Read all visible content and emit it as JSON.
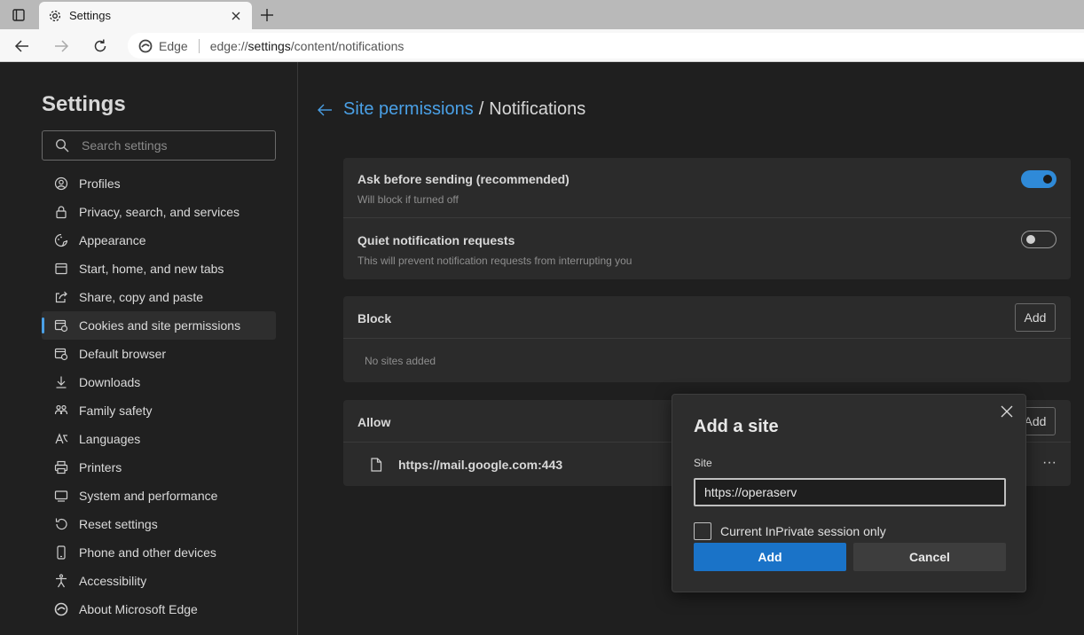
{
  "colors": {
    "accent": "#4aa0e6",
    "primary_button": "#1a73c8",
    "toggle_on": "#2f8ad8",
    "background": "#1f1f1f",
    "card": "#2b2b2b"
  },
  "browser": {
    "tab": {
      "title": "Settings",
      "icon": "gear-icon"
    },
    "address": {
      "edge_label": "Edge",
      "url_prefix": "edge://",
      "url_host": "settings",
      "url_path": "/content/notifications"
    }
  },
  "sidebar": {
    "title": "Settings",
    "search_placeholder": "Search settings",
    "items": [
      {
        "label": "Profiles",
        "icon": "profile-icon"
      },
      {
        "label": "Privacy, search, and services",
        "icon": "lock-icon"
      },
      {
        "label": "Appearance",
        "icon": "appearance-icon"
      },
      {
        "label": "Start, home, and new tabs",
        "icon": "home-tabs-icon"
      },
      {
        "label": "Share, copy and paste",
        "icon": "share-icon"
      },
      {
        "label": "Cookies and site permissions",
        "icon": "cookies-icon",
        "active": true
      },
      {
        "label": "Default browser",
        "icon": "default-browser-icon"
      },
      {
        "label": "Downloads",
        "icon": "download-icon"
      },
      {
        "label": "Family safety",
        "icon": "family-icon"
      },
      {
        "label": "Languages",
        "icon": "languages-icon"
      },
      {
        "label": "Printers",
        "icon": "printer-icon"
      },
      {
        "label": "System and performance",
        "icon": "system-icon"
      },
      {
        "label": "Reset settings",
        "icon": "reset-icon"
      },
      {
        "label": "Phone and other devices",
        "icon": "phone-icon"
      },
      {
        "label": "Accessibility",
        "icon": "accessibility-icon"
      },
      {
        "label": "About Microsoft Edge",
        "icon": "edge-logo-icon"
      }
    ]
  },
  "main": {
    "breadcrumb": {
      "parent": "Site permissions",
      "separator": "/",
      "current": "Notifications"
    },
    "settings": [
      {
        "title": "Ask before sending (recommended)",
        "subtitle": "Will block if turned off",
        "enabled": true
      },
      {
        "title": "Quiet notification requests",
        "subtitle": "This will prevent notification requests from interrupting you",
        "enabled": false
      }
    ],
    "block": {
      "title": "Block",
      "add_label": "Add",
      "empty_text": "No sites added"
    },
    "allow": {
      "title": "Allow",
      "add_label": "Add",
      "sites": [
        {
          "url": "https://mail.google.com:443",
          "more": "···"
        }
      ]
    }
  },
  "dialog": {
    "title": "Add a site",
    "site_label": "Site",
    "site_value": "https://operaserv",
    "checkbox_label": "Current InPrivate session only",
    "checkbox_checked": false,
    "add_label": "Add",
    "cancel_label": "Cancel"
  }
}
